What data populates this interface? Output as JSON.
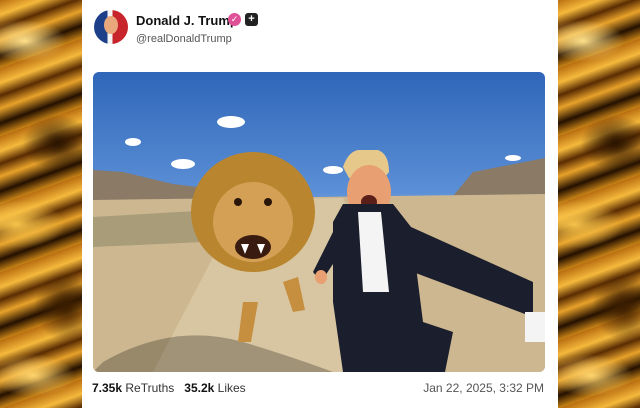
{
  "post": {
    "author_name": "Donald J. Trump",
    "author_handle": "@realDonaldTrump",
    "verified_icon": "verified-badge-icon",
    "plus_icon": "plus-badge-icon",
    "retruths_count": "7.35k",
    "retruths_label": "ReTruths",
    "likes_count": "35.2k",
    "likes_label": "Likes",
    "timestamp": "Jan 22, 2025, 3:32 PM"
  },
  "colors": {
    "verified_badge": "#e05297",
    "plus_badge": "#222222",
    "card_background": "#ffffff",
    "side_panels": "#c98416"
  }
}
